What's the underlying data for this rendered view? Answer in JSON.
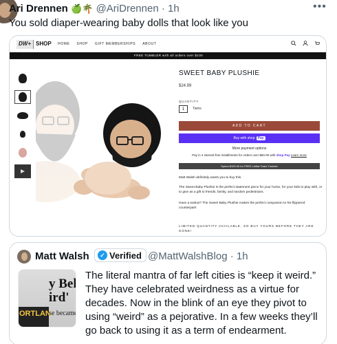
{
  "tweet": {
    "author_name": "Ari Drennen",
    "emojis": "🍏🌴",
    "handle": "@AriDrennen",
    "time": "· 1h",
    "text": "You sold diaper-wearing baby dolls that look like you"
  },
  "shop": {
    "logo_dw": "DW+",
    "logo_shop": "SHOP",
    "nav": [
      "HOME",
      "SHOP",
      "GIFT MEMBERSHIPS",
      "ABOUT"
    ],
    "banner": "FREE TUMBLER with all orders over $100",
    "product_name": "SWEET BABY PLUSHIE",
    "price": "$24.99",
    "quantity_label": "QUANTITY",
    "quantity_value": "1",
    "variant": "Twins",
    "add_to_cart": "ADD TO CART",
    "buy_with": "Buy with",
    "shop_pay": "Pay",
    "more_payment": "More payment options",
    "installments": "Pay in 4 interest-free installments for orders over $50.00 with",
    "installments_brand": "shop Pay",
    "learn_more": "Learn more",
    "spend": "Spend $100.00 for FREE Leftist Tears Tumbler",
    "desc1": "Matt Walsh definitely wants you to buy this.",
    "desc2": "The Sweet Baby Plushie is the perfect statement piece for your home, for your kids to play with, or to give as a gift to friends, family, and random pedestrians.",
    "desc3": "Have a walrus? The Sweet Baby Plushie makes the perfect companion to his flippered counterpart!",
    "limited": "LIMITED QUANTITY AVAILABLE, SO BUY YOURS BEFORE THEY ARE GONE!",
    "colors": {
      "add_to_cart": "#9b4a3a",
      "shop_pay": "#5a31f4"
    }
  },
  "quote": {
    "author_name": "Matt Walsh",
    "verified_label": "Verified",
    "handle": "@MattWalshBlog · 1h",
    "thumb_line1": "y Beh",
    "thumb_line2": "ird'",
    "thumb_line3": "ORTLAN",
    "thumb_line4": "se became",
    "text": "The literal mantra of far left cities is “keep it weird.” They have celebrated weirdness as a virtue for decades. Now in the blink of an eye they pivot to using “weird” as a pejorative. In a few weeks they’ll go back to using it as a term of endearment."
  }
}
